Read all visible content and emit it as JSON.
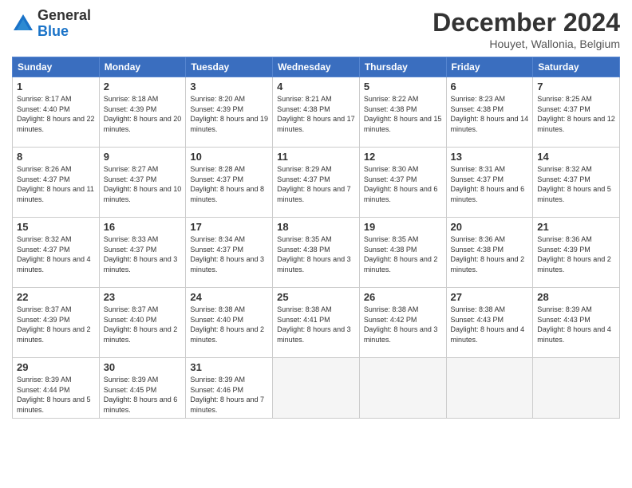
{
  "logo": {
    "general": "General",
    "blue": "Blue"
  },
  "title": "December 2024",
  "subtitle": "Houyet, Wallonia, Belgium",
  "days_of_week": [
    "Sunday",
    "Monday",
    "Tuesday",
    "Wednesday",
    "Thursday",
    "Friday",
    "Saturday"
  ],
  "weeks": [
    [
      {
        "day": "1",
        "sunrise": "8:17 AM",
        "sunset": "4:40 PM",
        "daylight": "8 hours and 22 minutes."
      },
      {
        "day": "2",
        "sunrise": "8:18 AM",
        "sunset": "4:39 PM",
        "daylight": "8 hours and 20 minutes."
      },
      {
        "day": "3",
        "sunrise": "8:20 AM",
        "sunset": "4:39 PM",
        "daylight": "8 hours and 19 minutes."
      },
      {
        "day": "4",
        "sunrise": "8:21 AM",
        "sunset": "4:38 PM",
        "daylight": "8 hours and 17 minutes."
      },
      {
        "day": "5",
        "sunrise": "8:22 AM",
        "sunset": "4:38 PM",
        "daylight": "8 hours and 15 minutes."
      },
      {
        "day": "6",
        "sunrise": "8:23 AM",
        "sunset": "4:38 PM",
        "daylight": "8 hours and 14 minutes."
      },
      {
        "day": "7",
        "sunrise": "8:25 AM",
        "sunset": "4:37 PM",
        "daylight": "8 hours and 12 minutes."
      }
    ],
    [
      {
        "day": "8",
        "sunrise": "8:26 AM",
        "sunset": "4:37 PM",
        "daylight": "8 hours and 11 minutes."
      },
      {
        "day": "9",
        "sunrise": "8:27 AM",
        "sunset": "4:37 PM",
        "daylight": "8 hours and 10 minutes."
      },
      {
        "day": "10",
        "sunrise": "8:28 AM",
        "sunset": "4:37 PM",
        "daylight": "8 hours and 8 minutes."
      },
      {
        "day": "11",
        "sunrise": "8:29 AM",
        "sunset": "4:37 PM",
        "daylight": "8 hours and 7 minutes."
      },
      {
        "day": "12",
        "sunrise": "8:30 AM",
        "sunset": "4:37 PM",
        "daylight": "8 hours and 6 minutes."
      },
      {
        "day": "13",
        "sunrise": "8:31 AM",
        "sunset": "4:37 PM",
        "daylight": "8 hours and 6 minutes."
      },
      {
        "day": "14",
        "sunrise": "8:32 AM",
        "sunset": "4:37 PM",
        "daylight": "8 hours and 5 minutes."
      }
    ],
    [
      {
        "day": "15",
        "sunrise": "8:32 AM",
        "sunset": "4:37 PM",
        "daylight": "8 hours and 4 minutes."
      },
      {
        "day": "16",
        "sunrise": "8:33 AM",
        "sunset": "4:37 PM",
        "daylight": "8 hours and 3 minutes."
      },
      {
        "day": "17",
        "sunrise": "8:34 AM",
        "sunset": "4:37 PM",
        "daylight": "8 hours and 3 minutes."
      },
      {
        "day": "18",
        "sunrise": "8:35 AM",
        "sunset": "4:38 PM",
        "daylight": "8 hours and 3 minutes."
      },
      {
        "day": "19",
        "sunrise": "8:35 AM",
        "sunset": "4:38 PM",
        "daylight": "8 hours and 2 minutes."
      },
      {
        "day": "20",
        "sunrise": "8:36 AM",
        "sunset": "4:38 PM",
        "daylight": "8 hours and 2 minutes."
      },
      {
        "day": "21",
        "sunrise": "8:36 AM",
        "sunset": "4:39 PM",
        "daylight": "8 hours and 2 minutes."
      }
    ],
    [
      {
        "day": "22",
        "sunrise": "8:37 AM",
        "sunset": "4:39 PM",
        "daylight": "8 hours and 2 minutes."
      },
      {
        "day": "23",
        "sunrise": "8:37 AM",
        "sunset": "4:40 PM",
        "daylight": "8 hours and 2 minutes."
      },
      {
        "day": "24",
        "sunrise": "8:38 AM",
        "sunset": "4:40 PM",
        "daylight": "8 hours and 2 minutes."
      },
      {
        "day": "25",
        "sunrise": "8:38 AM",
        "sunset": "4:41 PM",
        "daylight": "8 hours and 3 minutes."
      },
      {
        "day": "26",
        "sunrise": "8:38 AM",
        "sunset": "4:42 PM",
        "daylight": "8 hours and 3 minutes."
      },
      {
        "day": "27",
        "sunrise": "8:38 AM",
        "sunset": "4:43 PM",
        "daylight": "8 hours and 4 minutes."
      },
      {
        "day": "28",
        "sunrise": "8:39 AM",
        "sunset": "4:43 PM",
        "daylight": "8 hours and 4 minutes."
      }
    ],
    [
      {
        "day": "29",
        "sunrise": "8:39 AM",
        "sunset": "4:44 PM",
        "daylight": "8 hours and 5 minutes."
      },
      {
        "day": "30",
        "sunrise": "8:39 AM",
        "sunset": "4:45 PM",
        "daylight": "8 hours and 6 minutes."
      },
      {
        "day": "31",
        "sunrise": "8:39 AM",
        "sunset": "4:46 PM",
        "daylight": "8 hours and 7 minutes."
      },
      null,
      null,
      null,
      null
    ]
  ],
  "labels": {
    "sunrise": "Sunrise: ",
    "sunset": "Sunset: ",
    "daylight": "Daylight: "
  }
}
